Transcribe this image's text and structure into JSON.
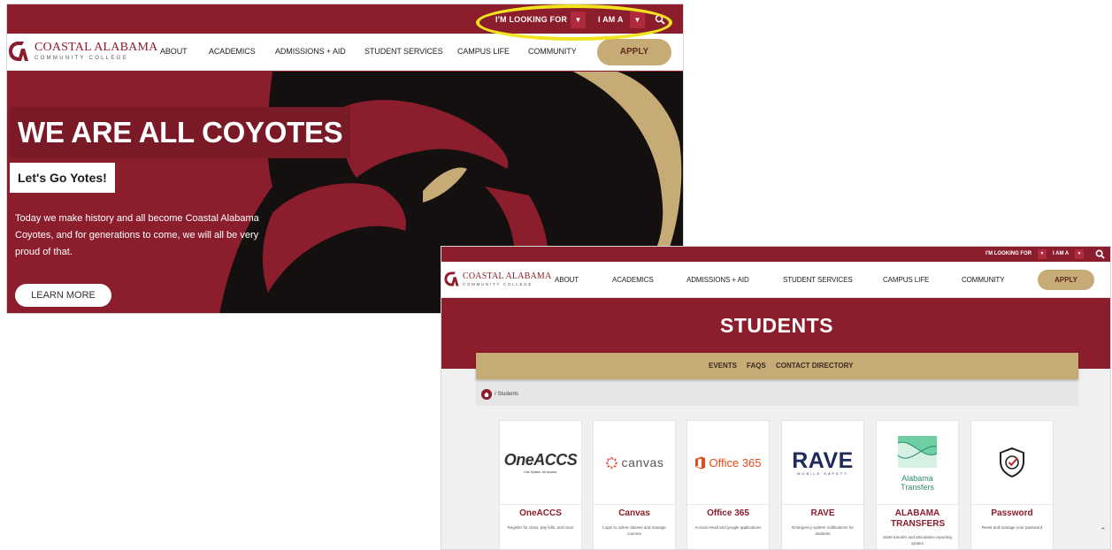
{
  "brand": {
    "name": "COASTAL ALABAMA",
    "subtitle": "COMMUNITY COLLEGE",
    "color": "#8b1d2c",
    "gold": "#c7ab77"
  },
  "utility": {
    "looking_for": "I'M LOOKING FOR",
    "i_am_a": "I AM A",
    "dropdown_icon": "caret-down-icon",
    "search_icon": "search-icon",
    "highlight_color": "#f1e31d"
  },
  "nav": {
    "items": [
      "ABOUT",
      "ACADEMICS",
      "ADMISSIONS + AID",
      "STUDENT SERVICES",
      "CAMPUS LIFE",
      "COMMUNITY"
    ],
    "apply": "APPLY"
  },
  "hero": {
    "title": "WE ARE ALL COYOTES",
    "subtitle": "Let's Go Yotes!",
    "body": "Today we make history and all become Coastal Alabama Coyotes, and for generations to come, we will all be very proud of that.",
    "button": "LEARN MORE"
  },
  "students_page": {
    "title": "STUDENTS",
    "subnav": [
      "EVENTS",
      "FAQS",
      "CONTACT DIRECTORY"
    ],
    "breadcrumb": "/ Students",
    "cards": [
      {
        "name": "OneACCS",
        "logo_text": "OneACCS",
        "logo_tagline": "One System. All Access.",
        "desc": "Register for class, pay bills, and more"
      },
      {
        "name": "Canvas",
        "logo_text": "canvas",
        "desc": "Login to online classes and manage courses"
      },
      {
        "name": "Office 365",
        "logo_text": "Office 365",
        "desc": "Access email and google applications"
      },
      {
        "name": "RAVE",
        "logo_text": "RAVE",
        "logo_tagline": "MOBILE SAFETY",
        "desc": "Emergency system notifications for students"
      },
      {
        "name": "ALABAMA TRANSFERS",
        "logo_text": "Alabama Transfers",
        "desc": "State transfer and articulation reporting system"
      },
      {
        "name": "Password",
        "logo_icon": "shield-check-icon",
        "desc": "Reset and manage your password"
      }
    ]
  }
}
